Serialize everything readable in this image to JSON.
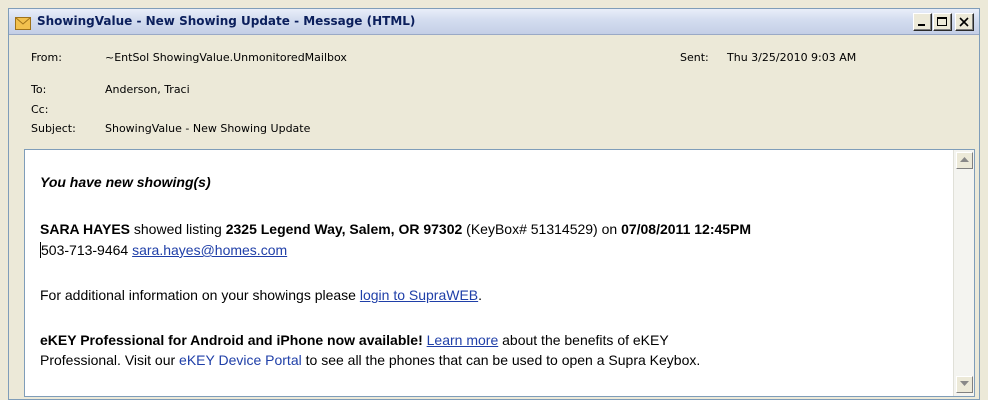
{
  "window": {
    "title": "ShowingValue - New Showing Update - Message (HTML)",
    "controls": {
      "minimize": "minimize",
      "maximize": "maximize",
      "close": "close"
    }
  },
  "headers": {
    "from_label": "From:",
    "from_value": "~EntSol ShowingValue.UnmonitoredMailbox",
    "sent_label": "Sent:",
    "sent_value": "Thu 3/25/2010 9:03 AM",
    "to_label": "To:",
    "to_value": "Anderson, Traci",
    "cc_label": "Cc:",
    "cc_value": "",
    "subject_label": "Subject:",
    "subject_value": "ShowingValue - New Showing Update"
  },
  "message": {
    "heading": "You have new showing(s)",
    "showing": {
      "agent": "SARA HAYES",
      "text1": " showed listing ",
      "address": "2325 Legend Way, Salem, OR 97302",
      "text2": " (KeyBox# 51314529) on ",
      "datetime": "07/08/2011 12:45PM"
    },
    "contact": {
      "phone_first_char": "5",
      "phone_rest": "03-713-9464 ",
      "email": "sara.hayes@homes.com"
    },
    "info": {
      "text": "For additional information on your showings please ",
      "link": "login to SupraWEB",
      "end": "."
    },
    "ekey": {
      "bold": "eKEY Professional for Android and iPhone now available!",
      "space": " ",
      "learn_more": "Learn more",
      "text1": " about the benefits of eKEY",
      "line2_start": "Professional. Visit our ",
      "portal": "eKEY Device Portal",
      "line2_end": " to see all the phones that can be used to open a Supra Keybox."
    }
  },
  "icons": {
    "title": "envelope-icon",
    "scroll_up": "arrow-up-icon",
    "scroll_down": "arrow-down-icon"
  },
  "colors": {
    "link": "#1f3fa8",
    "title_text": "#0b1f5c",
    "envelope": "#f2c14e"
  }
}
